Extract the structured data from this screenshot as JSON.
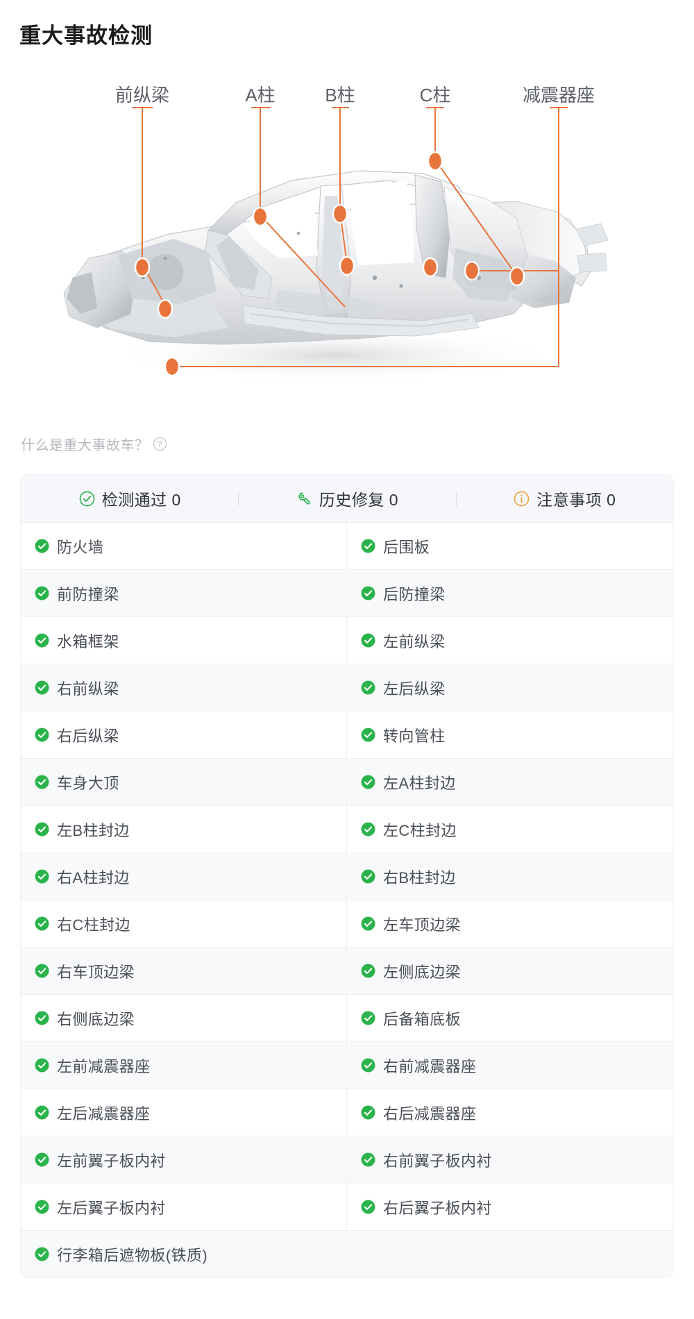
{
  "page": {
    "title": "重大事故检测"
  },
  "diagram": {
    "alt_name": "car-body-frame-illustration",
    "accent_color": "#E8743B",
    "labels": [
      {
        "text": "前纵梁"
      },
      {
        "text": "A柱"
      },
      {
        "text": "B柱"
      },
      {
        "text": "C柱"
      },
      {
        "text": "减震器座"
      }
    ]
  },
  "help": {
    "text": "什么是重大事故车？",
    "icon": "question-circle-icon"
  },
  "tabs": [
    {
      "label": "检测通过 0",
      "icon": "check-circle-outline-icon",
      "color": "#2FB357"
    },
    {
      "label": "历史修复 0",
      "icon": "repair-wrench-icon",
      "color": "#2FB357"
    },
    {
      "label": "注意事项 0",
      "icon": "info-circle-icon",
      "color": "#E8A33D"
    }
  ],
  "colors": {
    "ok_green": "#2BB34B",
    "accent_orange": "#E8743B",
    "warn_orange": "#E8A33D",
    "row_alt": "#F8F9FB",
    "header_bg": "#F5F7FA"
  },
  "items": [
    [
      "防火墙",
      "后围板"
    ],
    [
      "前防撞梁",
      "后防撞梁"
    ],
    [
      "水箱框架",
      "左前纵梁"
    ],
    [
      "右前纵梁",
      "左后纵梁"
    ],
    [
      "右后纵梁",
      "转向管柱"
    ],
    [
      "车身大顶",
      "左A柱封边"
    ],
    [
      "左B柱封边",
      "左C柱封边"
    ],
    [
      "右A柱封边",
      "右B柱封边"
    ],
    [
      "右C柱封边",
      "左车顶边梁"
    ],
    [
      "右车顶边梁",
      "左侧底边梁"
    ],
    [
      "右侧底边梁",
      "后备箱底板"
    ],
    [
      "左前减震器座",
      "右前减震器座"
    ],
    [
      "左后减震器座",
      "右后减震器座"
    ],
    [
      "左前翼子板内衬",
      "右前翼子板内衬"
    ],
    [
      "左后翼子板内衬",
      "右后翼子板内衬"
    ],
    [
      "行李箱后遮物板(铁质)"
    ]
  ]
}
